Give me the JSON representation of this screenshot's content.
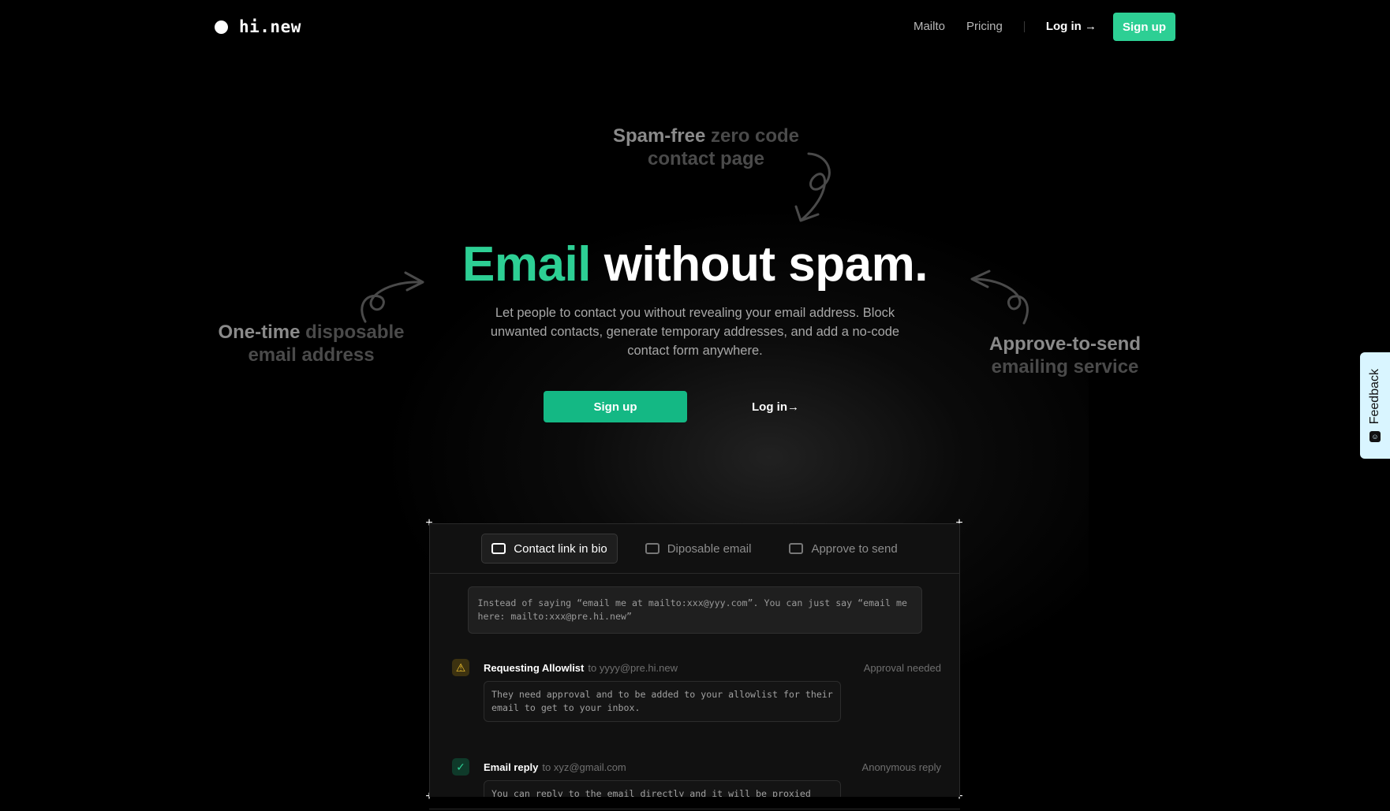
{
  "nav": {
    "brand": "hi.new",
    "links": [
      "Mailto",
      "Pricing"
    ],
    "login": "Log in →",
    "signup": "Sign up"
  },
  "hero": {
    "anno_top": {
      "strong": "Spam-free",
      "weak": "zero code contact page"
    },
    "anno_left": {
      "strong": "One-time",
      "weak": "disposable email address"
    },
    "anno_right": {
      "strong": "Approve-to-send",
      "weak": "emailing service"
    },
    "title_green": "Email",
    "title_rest": "without spam.",
    "subtitle": "Let people to contact you without revealing your email address. Block unwanted contacts, generate temporary addresses, and add a no-code contact form anywhere.",
    "signup": "Sign up",
    "login": "Log in→"
  },
  "feedback": {
    "label": "Feedback"
  },
  "demo": {
    "tabs": [
      {
        "label": "Contact link in bio",
        "icon": "inbox-icon",
        "active": true
      },
      {
        "label": "Diposable email",
        "icon": "tray-icon",
        "active": false
      },
      {
        "label": "Approve to send",
        "icon": "archive-icon",
        "active": false
      }
    ],
    "note": "Instead of saying “email me at mailto:xxx@yyy.com”. You can just say “email me here: mailto:xxx@pre.hi.new”",
    "rows": [
      {
        "icon": "warning-icon",
        "title": "Requesting Allowlist",
        "to": "to yyyy@pre.hi.new",
        "tag": "Approval needed",
        "body": "They need approval and to be added to your allowlist for their email to get to your inbox."
      },
      {
        "icon": "check-icon",
        "title": "Email reply",
        "to": "to xyz@gmail.com",
        "tag": "Anonymous reply",
        "body": "You can reply to the email directly and it will be proxied through your"
      }
    ]
  },
  "colors": {
    "accent": "#2dcf94",
    "background": "#000000"
  }
}
